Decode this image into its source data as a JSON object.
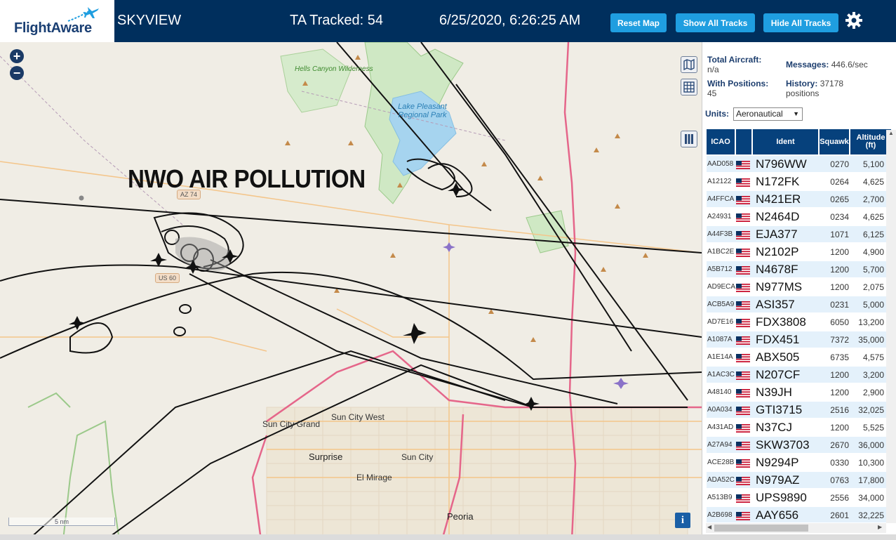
{
  "header": {
    "logo": "FlightAware",
    "title": "SKYVIEW",
    "tracked": "TA Tracked: 54",
    "datetime": "6/25/2020, 6:26:25 AM",
    "reset_label": "Reset Map",
    "show_label": "Show All Tracks",
    "hide_label": "Hide All Tracks",
    "accent_color": "#1f9ee0",
    "bar_color": "#002f5d"
  },
  "map": {
    "zoom_in": "+",
    "zoom_out": "−",
    "overlay_title": "NWO AIR POLLUTION",
    "scale_label": "5 nm",
    "info_label": "i",
    "labels": {
      "hells_canyon": "Hells Canyon Wilderness",
      "lake_pleasant": "Lake Pleasant Regional Park",
      "sun_city_grand": "Sun City Grand",
      "sun_city_west": "Sun City West",
      "surprise": "Surprise",
      "sun_city": "Sun City",
      "el_mirage": "El Mirage",
      "peoria": "Peoria",
      "az74": "AZ 74",
      "us60": "US 60"
    }
  },
  "panel": {
    "total_aircraft_label": "Total Aircraft:",
    "total_aircraft_value": "n/a",
    "messages_label": "Messages:",
    "messages_value": "446.6/sec",
    "with_positions_label": "With Positions:",
    "with_positions_value": "45",
    "history_label": "History:",
    "history_value": "37178 positions",
    "units_label": "Units:",
    "units_value": "Aeronautical",
    "columns": [
      "ICAO",
      "",
      "Ident",
      "Squawk",
      "Altitude (ft)"
    ],
    "rows": [
      {
        "icao": "AAD058",
        "ident": "N796WW",
        "squawk": "0270",
        "alt": "5,100",
        "trend": "▼"
      },
      {
        "icao": "A12122",
        "ident": "N172FK",
        "squawk": "0264",
        "alt": "4,625",
        "trend": ""
      },
      {
        "icao": "A4FFCA",
        "ident": "N421ER",
        "squawk": "0265",
        "alt": "2,700",
        "trend": "▲"
      },
      {
        "icao": "A24931",
        "ident": "N2464D",
        "squawk": "0234",
        "alt": "4,625",
        "trend": "▲"
      },
      {
        "icao": "A44F3B",
        "ident": "EJA377",
        "squawk": "1071",
        "alt": "6,125",
        "trend": ""
      },
      {
        "icao": "A1BC2E",
        "ident": "N2102P",
        "squawk": "1200",
        "alt": "4,900",
        "trend": "▼"
      },
      {
        "icao": "A5B712",
        "ident": "N4678F",
        "squawk": "1200",
        "alt": "5,700",
        "trend": ""
      },
      {
        "icao": "AD9ECA",
        "ident": "N977MS",
        "squawk": "1200",
        "alt": "2,075",
        "trend": ""
      },
      {
        "icao": "ACB5A9",
        "ident": "ASI357",
        "squawk": "0231",
        "alt": "5,000",
        "trend": "▲"
      },
      {
        "icao": "AD7E16",
        "ident": "FDX3808",
        "squawk": "6050",
        "alt": "13,200",
        "trend": "▼"
      },
      {
        "icao": "A1087A",
        "ident": "FDX451",
        "squawk": "7372",
        "alt": "35,000",
        "trend": ""
      },
      {
        "icao": "A1E14A",
        "ident": "ABX505",
        "squawk": "6735",
        "alt": "4,575",
        "trend": "▼"
      },
      {
        "icao": "A1AC3C",
        "ident": "N207CF",
        "squawk": "1200",
        "alt": "3,200",
        "trend": ""
      },
      {
        "icao": "A48140",
        "ident": "N39JH",
        "squawk": "1200",
        "alt": "2,900",
        "trend": ""
      },
      {
        "icao": "A0A034",
        "ident": "GTI3715",
        "squawk": "2516",
        "alt": "32,025",
        "trend": "▼"
      },
      {
        "icao": "A431AD",
        "ident": "N37CJ",
        "squawk": "1200",
        "alt": "5,525",
        "trend": "▼"
      },
      {
        "icao": "A27A94",
        "ident": "SKW3703",
        "squawk": "2670",
        "alt": "36,000",
        "trend": ""
      },
      {
        "icao": "ACE28B",
        "ident": "N9294P",
        "squawk": "0330",
        "alt": "10,300",
        "trend": "▲"
      },
      {
        "icao": "ADA52C",
        "ident": "N979AZ",
        "squawk": "0763",
        "alt": "17,800",
        "trend": "▲"
      },
      {
        "icao": "A513B9",
        "ident": "UPS9890",
        "squawk": "2556",
        "alt": "34,000",
        "trend": ""
      },
      {
        "icao": "A2B698",
        "ident": "AAY656",
        "squawk": "2601",
        "alt": "32,225",
        "trend": "▲"
      }
    ]
  }
}
